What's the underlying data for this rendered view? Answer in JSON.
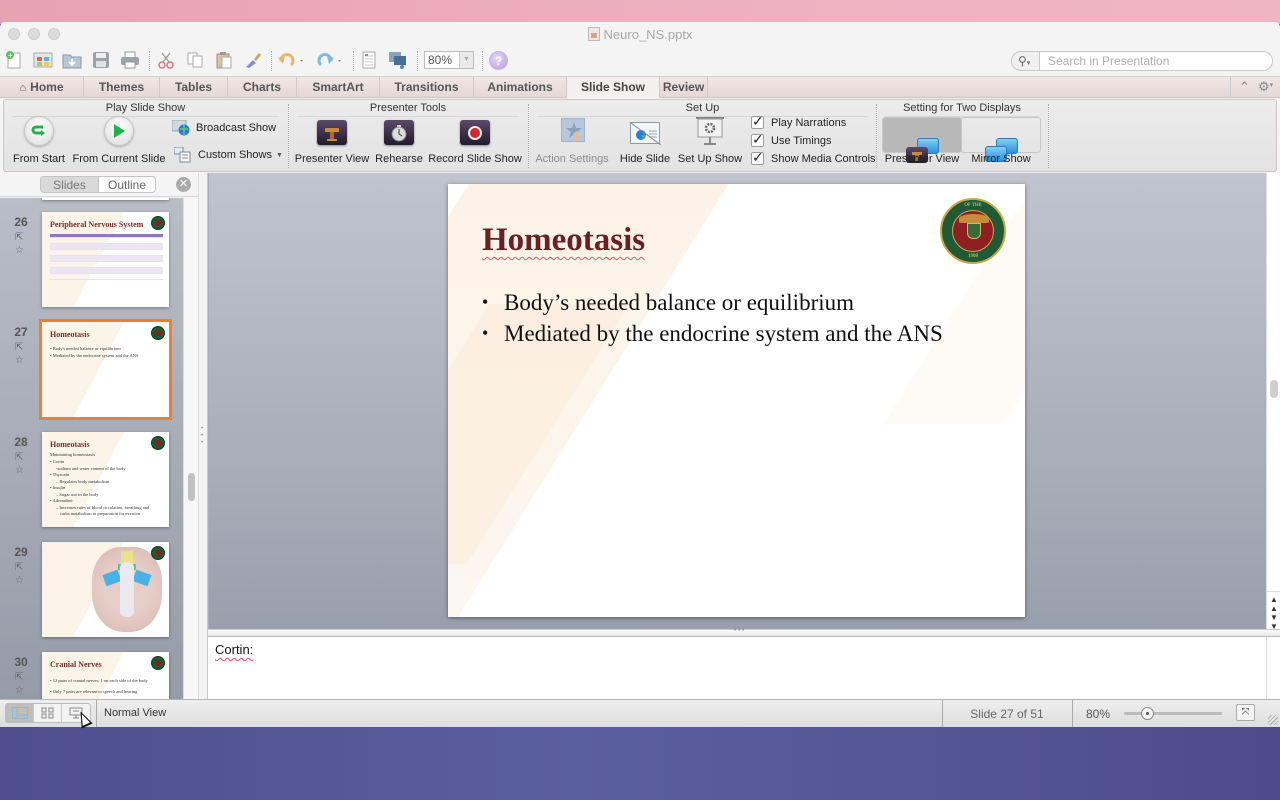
{
  "window": {
    "title": "Neuro_NS.pptx"
  },
  "toolbar": {
    "icons": [
      "new-icon",
      "gallery-icon",
      "open-icon",
      "save-icon",
      "print-icon",
      "cut-icon",
      "copy-icon",
      "paste-icon",
      "format-painter-icon",
      "undo-icon",
      "redo-icon",
      "show-toolbox-icon",
      "media-browser-icon"
    ],
    "zoom_value": "80%",
    "help_label": "?",
    "search_placeholder": "Search in Presentation"
  },
  "tabs": [
    {
      "label": "Home",
      "active": false
    },
    {
      "label": "Themes",
      "active": false
    },
    {
      "label": "Tables",
      "active": false
    },
    {
      "label": "Charts",
      "active": false
    },
    {
      "label": "SmartArt",
      "active": false
    },
    {
      "label": "Transitions",
      "active": false
    },
    {
      "label": "Animations",
      "active": false
    },
    {
      "label": "Slide Show",
      "active": true
    },
    {
      "label": "Review",
      "active": false
    }
  ],
  "ribbon": {
    "play": {
      "title": "Play Slide Show",
      "from_start": "From Start",
      "from_current": "From Current Slide",
      "broadcast": "Broadcast Show",
      "custom_shows": "Custom Shows"
    },
    "presenter_tools": {
      "title": "Presenter Tools",
      "presenter_view": "Presenter View",
      "rehearse": "Rehearse",
      "record": "Record Slide Show"
    },
    "setup": {
      "title": "Set Up",
      "action_settings": "Action Settings",
      "hide_slide": "Hide Slide",
      "setup_show": "Set Up Show",
      "play_narrations": {
        "label": "Play Narrations",
        "checked": true
      },
      "use_timings": {
        "label": "Use Timings",
        "checked": true
      },
      "show_media_controls": {
        "label": "Show Media Controls",
        "checked": true
      }
    },
    "two_displays": {
      "title": "Setting for Two Displays",
      "presenter_view": "Presenter View",
      "mirror_show": "Mirror Show",
      "selected": "Presenter View"
    }
  },
  "left_pane": {
    "tab_slides": "Slides",
    "tab_outline": "Outline",
    "active_tab": "Outline",
    "thumbnails": [
      {
        "number": "26",
        "title": "Peripheral Nervous System",
        "lines": []
      },
      {
        "number": "27",
        "title": "Homeotasis",
        "selected": true,
        "lines": [
          "• Body's needed balance or equilibrium",
          "• Mediated by the endocrine system and the ANS"
        ]
      },
      {
        "number": "28",
        "title": "Homeotasis",
        "lines": [
          "Maintaining homeostasis",
          "• Cortin",
          "-sodium and water content of the body",
          "• Thyroxin",
          "– Regulates body metabolism",
          "• Insulin",
          "– Sugar use in the body",
          "• Adrenaline",
          "– Increases rates of blood circulation, breathing and",
          "carbs metabolism in preparation for exertion"
        ]
      },
      {
        "number": "29",
        "title": "",
        "lines": []
      },
      {
        "number": "30",
        "title": "Cranial Nerves",
        "lines": [
          "• 12 pairs of cranial nerves; 1 on each side of the body",
          "• Only 7 pairs are relevant to speech and hearing"
        ]
      }
    ]
  },
  "slide": {
    "title": "Homeotasis",
    "bullets": [
      "Body’s needed balance or equilibrium",
      "Mediated by the endocrine system and the ANS"
    ],
    "seal": {
      "top_text": "OF THE",
      "year": "1908"
    },
    "title_color": "#6b2123"
  },
  "notes": {
    "text": "Cortin:"
  },
  "statusbar": {
    "view_label": "Normal View",
    "slide_counter": "Slide 27 of 51",
    "zoom": "80%",
    "zoom_fraction": 0.2
  },
  "colors": {
    "selected_thumb": "#f07f2d",
    "slide_title": "#6b2123"
  }
}
